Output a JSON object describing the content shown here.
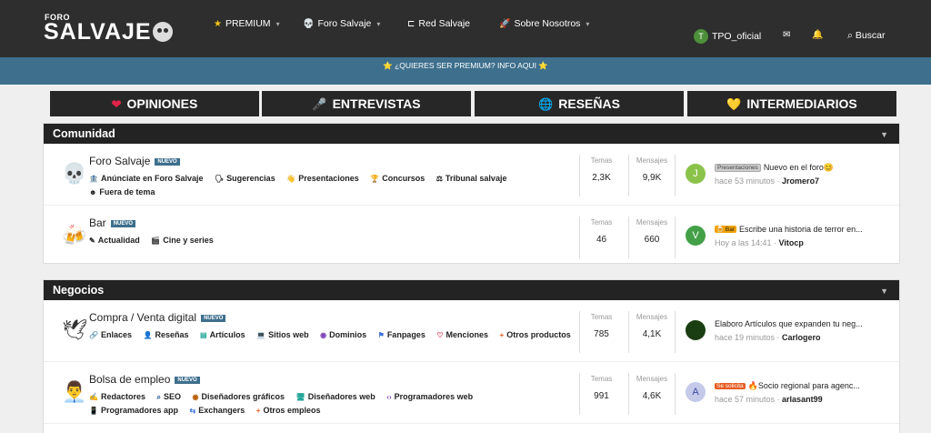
{
  "logo": {
    "small": "FORO",
    "big": "SALVAJE"
  },
  "nav": [
    {
      "icon": "★",
      "label": "PREMIUM",
      "caret": "▾"
    },
    {
      "icon": "💀",
      "label": "Foro Salvaje",
      "caret": "▾"
    },
    {
      "icon": "⊏",
      "label": "Red Salvaje",
      "caret": ""
    },
    {
      "icon": "🚀",
      "label": "Sobre Nosotros",
      "caret": "▾"
    }
  ],
  "user": {
    "initial": "T",
    "name": "TPO_oficial",
    "mail_icon": "✉",
    "bell_icon": "🔔"
  },
  "search_label": "Buscar",
  "promo": "⭐ ¿QUIERES SER PREMIUM? INFO AQUI ⭐",
  "categories": [
    {
      "icon": "❤",
      "label": "OPINIONES",
      "color": "#e0234a"
    },
    {
      "icon": "🎤",
      "label": "ENTREVISTAS",
      "color": "#ffffff"
    },
    {
      "icon": "🌐",
      "label": "RESEÑAS",
      "color": "#3b9bd9"
    },
    {
      "icon": "💛",
      "label": "INTERMEDIARIOS",
      "color": "#f5c518"
    }
  ],
  "stat_labels": {
    "topics": "Temas",
    "posts": "Mensajes"
  },
  "sections": [
    {
      "title": "Comunidad",
      "forums": [
        {
          "icon": "💀",
          "title": "Foro Salvaje",
          "badge": "NUEVO",
          "subs": [
            {
              "icon": "🏦",
              "label": "Anúnciate en Foro Salvaje"
            },
            {
              "icon": "🗣",
              "label": "Sugerencias"
            },
            {
              "icon": "👋",
              "label": "Presentaciones"
            },
            {
              "icon": "🏆",
              "label": "Concursos"
            },
            {
              "icon": "⚖",
              "label": "Tribunal salvaje"
            },
            {
              "icon": "☻",
              "label": "Fuera de tema"
            }
          ],
          "topics": "2,3K",
          "posts": "9,9K",
          "last": {
            "initial": "J",
            "avatar_color": "#8bc34a",
            "tag": "Presentaciones",
            "tag_style": "tag-gray",
            "title": "Nuevo en el foro😊",
            "time": "hace 53 minutos",
            "user": "Jromero7"
          }
        },
        {
          "icon": "🍻",
          "title": "Bar",
          "badge": "NUEVO",
          "subs": [
            {
              "icon": "✎",
              "label": "Actualidad"
            },
            {
              "icon": "🎬",
              "label": "Cine y series"
            }
          ],
          "topics": "46",
          "posts": "660",
          "last": {
            "initial": "V",
            "avatar_color": "#43a047",
            "tag": "🍺 Bar",
            "tag_style": "tag-orange",
            "title": "Escribe una historia de terror en...",
            "time": "Hoy a las 14:41",
            "user": "Vitocp"
          }
        }
      ]
    },
    {
      "title": "Negocios",
      "forums": [
        {
          "icon": "🕊",
          "title": "Compra / Venta digital",
          "badge": "NUEVO",
          "subs": [
            {
              "icon": "🔗",
              "label": "Enlaces"
            },
            {
              "icon": "👤",
              "label": "Reseñas"
            },
            {
              "icon": "▤",
              "label": "Artículos"
            },
            {
              "icon": "💻",
              "label": "Sitios web"
            },
            {
              "icon": "◉",
              "label": "Dominios"
            },
            {
              "icon": "⚑",
              "label": "Fanpages"
            },
            {
              "icon": "♡",
              "label": "Menciones"
            },
            {
              "icon": "+",
              "label": "Otros productos"
            }
          ],
          "topics": "785",
          "posts": "4,1K",
          "last": {
            "initial": "",
            "avatar_color": "#1a3d12",
            "tag": "",
            "tag_style": "",
            "title": "Elaboro Artículos que expanden tu neg...",
            "time": "hace 19 minutos",
            "user": "Carlogero"
          }
        },
        {
          "icon": "👨‍💼",
          "title": "Bolsa de empleo",
          "badge": "NUEVO",
          "subs": [
            {
              "icon": "✍",
              "label": "Redactores"
            },
            {
              "icon": "⌕",
              "label": "SEO"
            },
            {
              "icon": "◉",
              "label": "Diseñadores gráficos"
            },
            {
              "icon": "🖥",
              "label": "Diseñadores web"
            },
            {
              "icon": "‹›",
              "label": "Programadores web"
            },
            {
              "icon": "📱",
              "label": "Programadores app"
            },
            {
              "icon": "⇆",
              "label": "Exchangers"
            },
            {
              "icon": "+",
              "label": "Otros empleos"
            }
          ],
          "topics": "991",
          "posts": "4,6K",
          "last": {
            "initial": "A",
            "avatar_color": "#c5cae9",
            "tag": "Se solicita",
            "tag_style": "tag-red",
            "title": "🔥Socio regional para agenc...",
            "time": "hace 57 minutos",
            "user": "arlasant99"
          }
        }
      ]
    }
  ]
}
